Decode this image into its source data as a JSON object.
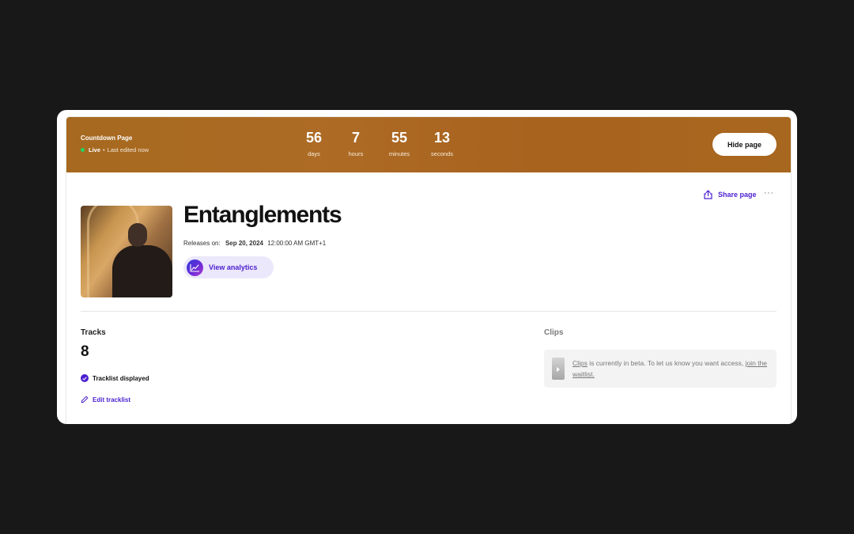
{
  "banner": {
    "title": "Countdown Page",
    "status_live": "Live",
    "status_separator": "•",
    "status_edited": "Last edited now",
    "countdown": [
      {
        "value": "56",
        "unit": "days"
      },
      {
        "value": "7",
        "unit": "hours"
      },
      {
        "value": "55",
        "unit": "minutes"
      },
      {
        "value": "13",
        "unit": "seconds"
      }
    ],
    "hide_button": "Hide page",
    "background_color": "#a8681f"
  },
  "actions": {
    "share_label": "Share page",
    "more_label": "···"
  },
  "release": {
    "title": "Entanglements",
    "releases_label": "Releases on:",
    "release_date": "Sep 20, 2024",
    "release_time": "12:00:00 AM GMT+1",
    "analytics_button": "View analytics"
  },
  "tracks": {
    "label": "Tracks",
    "count": "8",
    "status": "Tracklist displayed",
    "edit_label": "Edit tracklist"
  },
  "clips": {
    "label": "Clips",
    "link_clips": "Clips",
    "text": " is currently in beta. To let us know you want access, ",
    "link_waitlist": "join the waitlist."
  },
  "colors": {
    "accent": "#4b1fd0",
    "live_dot": "#27d160",
    "page_background": "#181818"
  }
}
